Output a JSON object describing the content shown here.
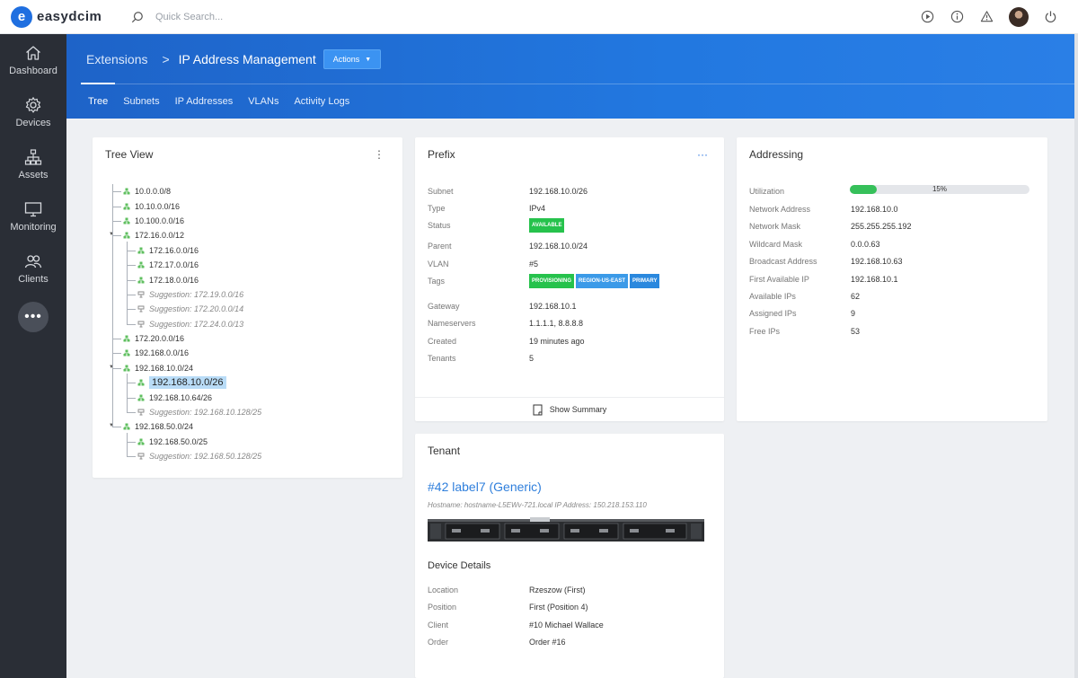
{
  "brand": {
    "logo_letter": "e",
    "name": "easydcim"
  },
  "search": {
    "placeholder": "Quick Search..."
  },
  "topbar": {
    "icons": [
      "play-icon",
      "info-icon",
      "warning-icon",
      "avatar",
      "power-icon"
    ]
  },
  "sidebar": {
    "items": [
      {
        "label": "Dashboard",
        "icon": "home-icon"
      },
      {
        "label": "Devices",
        "icon": "gear-icon"
      },
      {
        "label": "Assets",
        "icon": "hierarchy-icon"
      },
      {
        "label": "Monitoring",
        "icon": "monitor-icon"
      },
      {
        "label": "Clients",
        "icon": "users-icon"
      }
    ],
    "more_label": "•••"
  },
  "header": {
    "crumb1": "Extensions",
    "separator": ">",
    "crumb2": "IP Address Management",
    "actions_label": "Actions",
    "tabs": [
      "Tree",
      "Subnets",
      "IP Addresses",
      "VLANs",
      "Activity Logs"
    ],
    "active_tab": "Tree"
  },
  "tree_view": {
    "title": "Tree View",
    "menu": "⋮",
    "nodes": [
      {
        "label": "10.0.0.0/8",
        "level": 0
      },
      {
        "label": "10.10.0.0/16",
        "level": 0
      },
      {
        "label": "10.100.0.0/16",
        "level": 0
      },
      {
        "label": "172.16.0.0/12",
        "level": 0,
        "expanded": true
      },
      {
        "label": "172.16.0.0/16",
        "level": 1
      },
      {
        "label": "172.17.0.0/16",
        "level": 1
      },
      {
        "label": "172.18.0.0/16",
        "level": 1
      },
      {
        "label": "Suggestion: 172.19.0.0/16",
        "level": 1,
        "suggestion": true
      },
      {
        "label": "Suggestion: 172.20.0.0/14",
        "level": 1,
        "suggestion": true
      },
      {
        "label": "Suggestion: 172.24.0.0/13",
        "level": 1,
        "suggestion": true
      },
      {
        "label": "172.20.0.0/16",
        "level": 0
      },
      {
        "label": "192.168.0.0/16",
        "level": 0
      },
      {
        "label": "192.168.10.0/24",
        "level": 0,
        "expanded": true
      },
      {
        "label": "192.168.10.0/26",
        "level": 1,
        "selected": true
      },
      {
        "label": "192.168.10.64/26",
        "level": 1
      },
      {
        "label": "Suggestion: 192.168.10.128/25",
        "level": 1,
        "suggestion": true
      },
      {
        "label": "192.168.50.0/24",
        "level": 0,
        "expanded": true
      },
      {
        "label": "192.168.50.0/25",
        "level": 1
      },
      {
        "label": "Suggestion: 192.168.50.128/25",
        "level": 1,
        "suggestion": true
      }
    ]
  },
  "prefix": {
    "title": "Prefix",
    "menu": "···",
    "subnet_label": "Subnet",
    "subnet": "192.168.10.0/26",
    "type_label": "Type",
    "type": "IPv4",
    "status_label": "Status",
    "status": "AVAILABLE",
    "parent_label": "Parent",
    "parent": "192.168.10.0/24",
    "vlan_label": "VLAN",
    "vlan": "#5",
    "tags_label": "Tags",
    "tags": [
      "PROVISIONING",
      "REGION-US-EAST",
      "PRIMARY"
    ],
    "gateway_label": "Gateway",
    "gateway": "192.168.10.1",
    "nameservers_label": "Nameservers",
    "nameservers": "1.1.1.1, 8.8.8.8",
    "created_label": "Created",
    "created": "19 minutes ago",
    "tenants_label": "Tenants",
    "tenants": "5",
    "show_summary": "Show Summary"
  },
  "addressing": {
    "title": "Addressing",
    "utilization_label": "Utilization",
    "utilization_pct": 15,
    "utilization_text": "15%",
    "rows": [
      {
        "k": "Network Address",
        "v": "192.168.10.0"
      },
      {
        "k": "Network Mask",
        "v": "255.255.255.192"
      },
      {
        "k": "Wildcard Mask",
        "v": "0.0.0.63"
      },
      {
        "k": "Broadcast Address",
        "v": "192.168.10.63"
      },
      {
        "k": "First Available IP",
        "v": "192.168.10.1"
      },
      {
        "k": "Available IPs",
        "v": "62"
      },
      {
        "k": "Assigned IPs",
        "v": "9"
      },
      {
        "k": "Free IPs",
        "v": "53"
      }
    ]
  },
  "tenant": {
    "title": "Tenant",
    "link": "#42 label7 (Generic)",
    "subtitle": "Hostname: hostname-L5EWv-721.local IP Address: 150.218.153.110",
    "device_details_title": "Device Details",
    "rows": [
      {
        "k": "Location",
        "v": "Rzeszow (First)"
      },
      {
        "k": "Position",
        "v": "First (Position 4)"
      },
      {
        "k": "Client",
        "v": "#10 Michael Wallace"
      },
      {
        "k": "Order",
        "v": "Order #16"
      }
    ]
  },
  "colors": {
    "accent": "#1f6fe0",
    "sidebar": "#2a2e36",
    "success": "#26c24c"
  }
}
